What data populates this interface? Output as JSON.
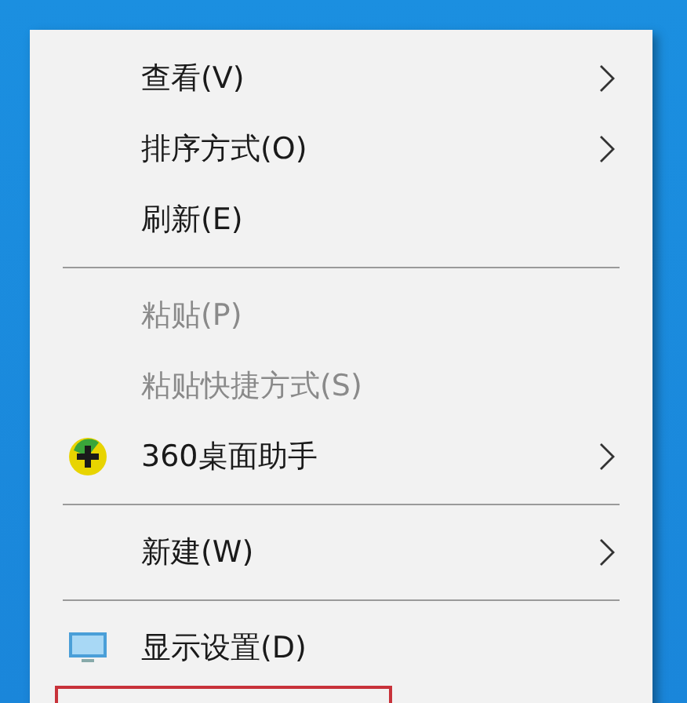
{
  "context_menu": {
    "items": [
      {
        "kind": "item",
        "label": "查看(V)",
        "disabled": false,
        "submenu": true
      },
      {
        "kind": "item",
        "label": "排序方式(O)",
        "disabled": false,
        "submenu": true
      },
      {
        "kind": "item",
        "label": "刷新(E)",
        "disabled": false,
        "submenu": false
      },
      {
        "kind": "separator"
      },
      {
        "kind": "item",
        "label": "粘贴(P)",
        "disabled": true,
        "submenu": false
      },
      {
        "kind": "item",
        "label": "粘贴快捷方式(S)",
        "disabled": true,
        "submenu": false
      },
      {
        "kind": "app_item",
        "label": "360桌面助手",
        "disabled": false,
        "submenu": true
      },
      {
        "kind": "separator"
      },
      {
        "kind": "item",
        "label": "新建(W)",
        "disabled": false,
        "submenu": true
      },
      {
        "kind": "separator"
      },
      {
        "kind": "display_item",
        "label": "显示设置(D)",
        "disabled": false,
        "submenu": false
      },
      {
        "kind": "cut_item",
        "outlined": true
      }
    ]
  }
}
